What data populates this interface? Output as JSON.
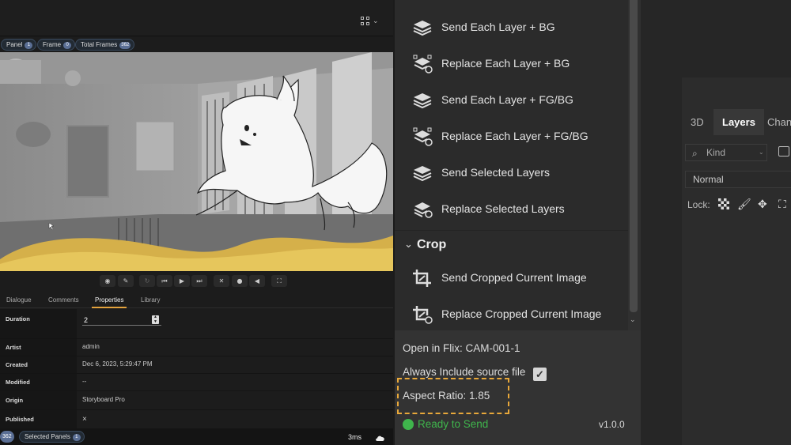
{
  "flix": {
    "pills": [
      {
        "label": "Panel",
        "count": "1"
      },
      {
        "label": "Frame",
        "count": "0"
      },
      {
        "label": "Total Frames",
        "count": "362"
      }
    ],
    "tabs": [
      "Dialogue",
      "Comments",
      "Properties",
      "Library"
    ],
    "active_tab": "Properties",
    "properties": {
      "duration_label": "Duration",
      "duration_value": "2",
      "artist_label": "Artist",
      "artist_value": "admin",
      "created_label": "Created",
      "created_value": "Dec 6, 2023, 5:29:47 PM",
      "modified_label": "Modified",
      "modified_value": "--",
      "origin_label": "Origin",
      "origin_value": "Storyboard Pro",
      "published_label": "Published",
      "published_value": "×"
    },
    "status": {
      "total_count": "362",
      "selected_label": "Selected Panels",
      "selected_count": "1",
      "timing": "3ms"
    }
  },
  "extension": {
    "menu_items": [
      {
        "label": "Send Each Layer + BG",
        "icon": "layers-send-icon"
      },
      {
        "label": "Replace Each Layer + BG",
        "icon": "layers-replace-icon"
      },
      {
        "label": "Send Each Layer + FG/BG",
        "icon": "layers-send-icon"
      },
      {
        "label": "Replace Each Layer + FG/BG",
        "icon": "layers-replace-icon"
      },
      {
        "label": "Send Selected Layers",
        "icon": "layers-send-icon"
      },
      {
        "label": "Replace Selected Layers",
        "icon": "layers-replace-icon"
      }
    ],
    "crop_section": {
      "title": "Crop",
      "items": [
        {
          "label": "Send Cropped Current Image",
          "icon": "crop-send-icon"
        },
        {
          "label": "Replace Cropped Current Image",
          "icon": "crop-replace-icon"
        }
      ]
    },
    "footer": {
      "open_in_flix": "Open in Flix: CAM-001-1",
      "include_source_label": "Always Include source file",
      "include_source_checked": true,
      "aspect_ratio": "Aspect Ratio: 1.85",
      "status": "Ready to Send",
      "status_color": "#3fb54c",
      "version": "v1.0.0",
      "highlight_color": "#e8a83a"
    }
  },
  "photoshop": {
    "tabs": [
      "3D",
      "Layers",
      "Chann"
    ],
    "active_tab": "Layers",
    "filter_placeholder": "Kind",
    "blend_mode": "Normal",
    "lock_label": "Lock:"
  }
}
